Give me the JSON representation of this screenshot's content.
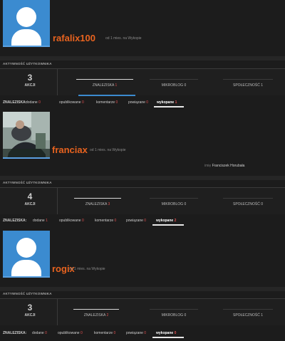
{
  "section_title": "AKTYWNOŚĆ UŻYTKOWNIKA",
  "akcje_label": "AKCJI",
  "tabs": {
    "znaleziska": "ZNALEZISKA",
    "mikroblog": "MIKROBLOG",
    "spolecznosc": "SPOŁECZNOŚĆ"
  },
  "filters_label": "ZNALEZISKA:",
  "filters": [
    "dodane",
    "opublikowane",
    "komentarze",
    "powiązane",
    "wykopane"
  ],
  "profiles": [
    {
      "username": "rafalix100",
      "meta": "od 1 mies. na Wykopie",
      "avatar": "default-avatar",
      "real_name": "",
      "real_name_prefix": "",
      "actions": "3",
      "znaleziska": "1",
      "mikroblog": "0",
      "spolecznosc": "1",
      "filter_counts": [
        "0",
        "0",
        "0",
        "0",
        "1"
      ]
    },
    {
      "username": "franciax",
      "meta": "od 1 mies. na Wykopie",
      "avatar": "photo",
      "real_name": "Franciszek Horubała",
      "real_name_prefix": "imię",
      "actions": "4",
      "znaleziska": "3",
      "mikroblog": "0",
      "spolecznosc": "0",
      "filter_counts": [
        "1",
        "0",
        "0",
        "0",
        "2"
      ]
    },
    {
      "username": "rogix",
      "meta": "od 1 mies. na Wykopie",
      "avatar": "default-avatar",
      "real_name": "",
      "real_name_prefix": "",
      "actions": "3",
      "znaleziska": "2",
      "mikroblog": "0",
      "spolecznosc": "1",
      "filter_counts": [
        "0",
        "0",
        "0",
        "0",
        "0"
      ]
    }
  ],
  "colors": {
    "accent": "#e8631f",
    "avatar_bg": "#3b8bd0",
    "count_red": "#e05050",
    "background": "#1c1c1c"
  }
}
